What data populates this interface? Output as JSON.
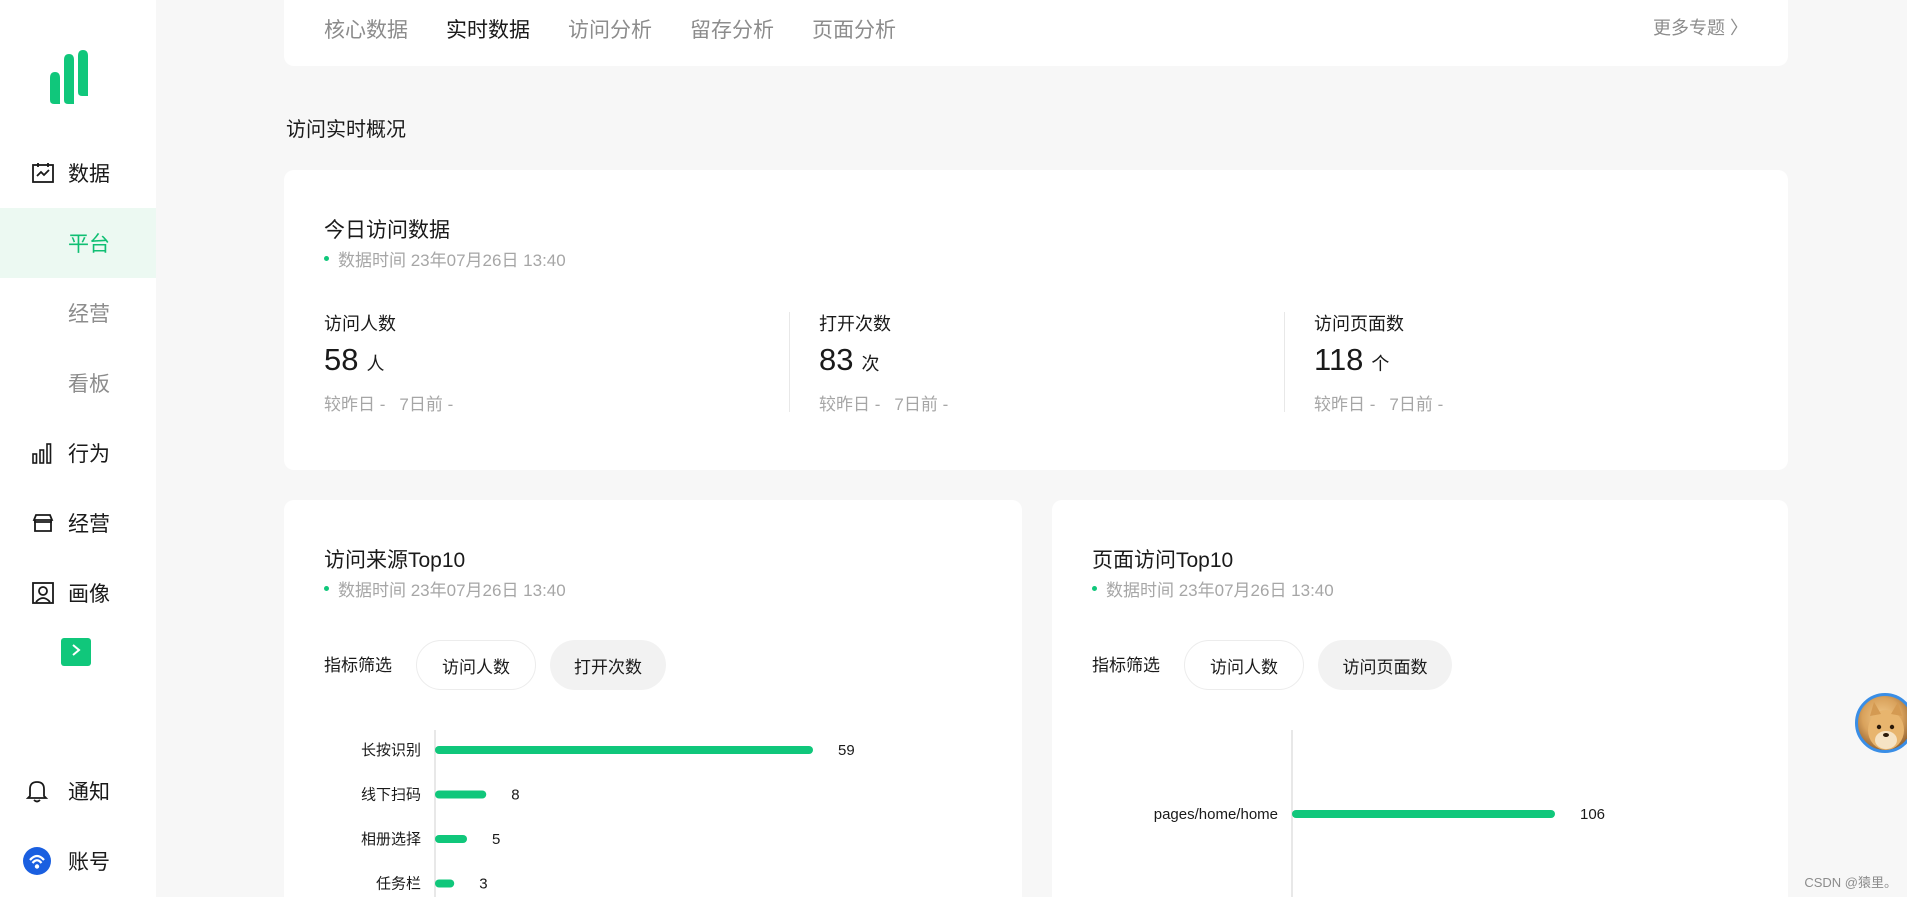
{
  "sidebar": {
    "items": [
      {
        "label": "数据",
        "icon": "calendar-chart-icon"
      },
      {
        "label": "行为",
        "icon": "bar-chart-icon"
      },
      {
        "label": "经营",
        "icon": "store-icon"
      },
      {
        "label": "画像",
        "icon": "portrait-icon"
      }
    ],
    "subitems": [
      {
        "label": "平台",
        "active": true
      },
      {
        "label": "经营",
        "active": false
      },
      {
        "label": "看板",
        "active": false
      }
    ],
    "notify_label": "通知",
    "account_label": "账号"
  },
  "tabs": [
    {
      "label": "核心数据",
      "active": false
    },
    {
      "label": "实时数据",
      "active": true
    },
    {
      "label": "访问分析",
      "active": false
    },
    {
      "label": "留存分析",
      "active": false
    },
    {
      "label": "页面分析",
      "active": false
    }
  ],
  "more_topics": "更多专题 〉",
  "section_title": "访问实时概况",
  "today": {
    "title": "今日访问数据",
    "timestamp": "数据时间 23年07月26日 13:40",
    "metrics": [
      {
        "label": "访问人数",
        "value": "58",
        "unit": "人",
        "cmp_day": "较昨日 -",
        "cmp_week": "7日前 -"
      },
      {
        "label": "打开次数",
        "value": "83",
        "unit": "次",
        "cmp_day": "较昨日 -",
        "cmp_week": "7日前 -"
      },
      {
        "label": "访问页面数",
        "value": "118",
        "unit": "个",
        "cmp_day": "较昨日 -",
        "cmp_week": "7日前 -"
      }
    ]
  },
  "source_top10": {
    "title": "访问来源Top10",
    "timestamp": "数据时间 23年07月26日 13:40",
    "filter_label": "指标筛选",
    "filters": [
      "访问人数",
      "打开次数"
    ]
  },
  "page_top10": {
    "title": "页面访问Top10",
    "timestamp": "数据时间 23年07月26日 13:40",
    "filter_label": "指标筛选",
    "filters": [
      "访问人数",
      "访问页面数"
    ]
  },
  "chart_data": [
    {
      "type": "bar",
      "orientation": "horizontal",
      "categories": [
        "长按识别",
        "线下扫码",
        "相册选择",
        "任务栏"
      ],
      "values": [
        59,
        8,
        5,
        3
      ],
      "color": "#10c77b"
    },
    {
      "type": "bar",
      "orientation": "horizontal",
      "categories": [
        "pages/home/home"
      ],
      "values": [
        106
      ],
      "color": "#10c77b"
    }
  ],
  "watermark": "CSDN @猿里。",
  "colors": {
    "accent": "#10c77b",
    "active_bg": "#ecf9f2"
  }
}
